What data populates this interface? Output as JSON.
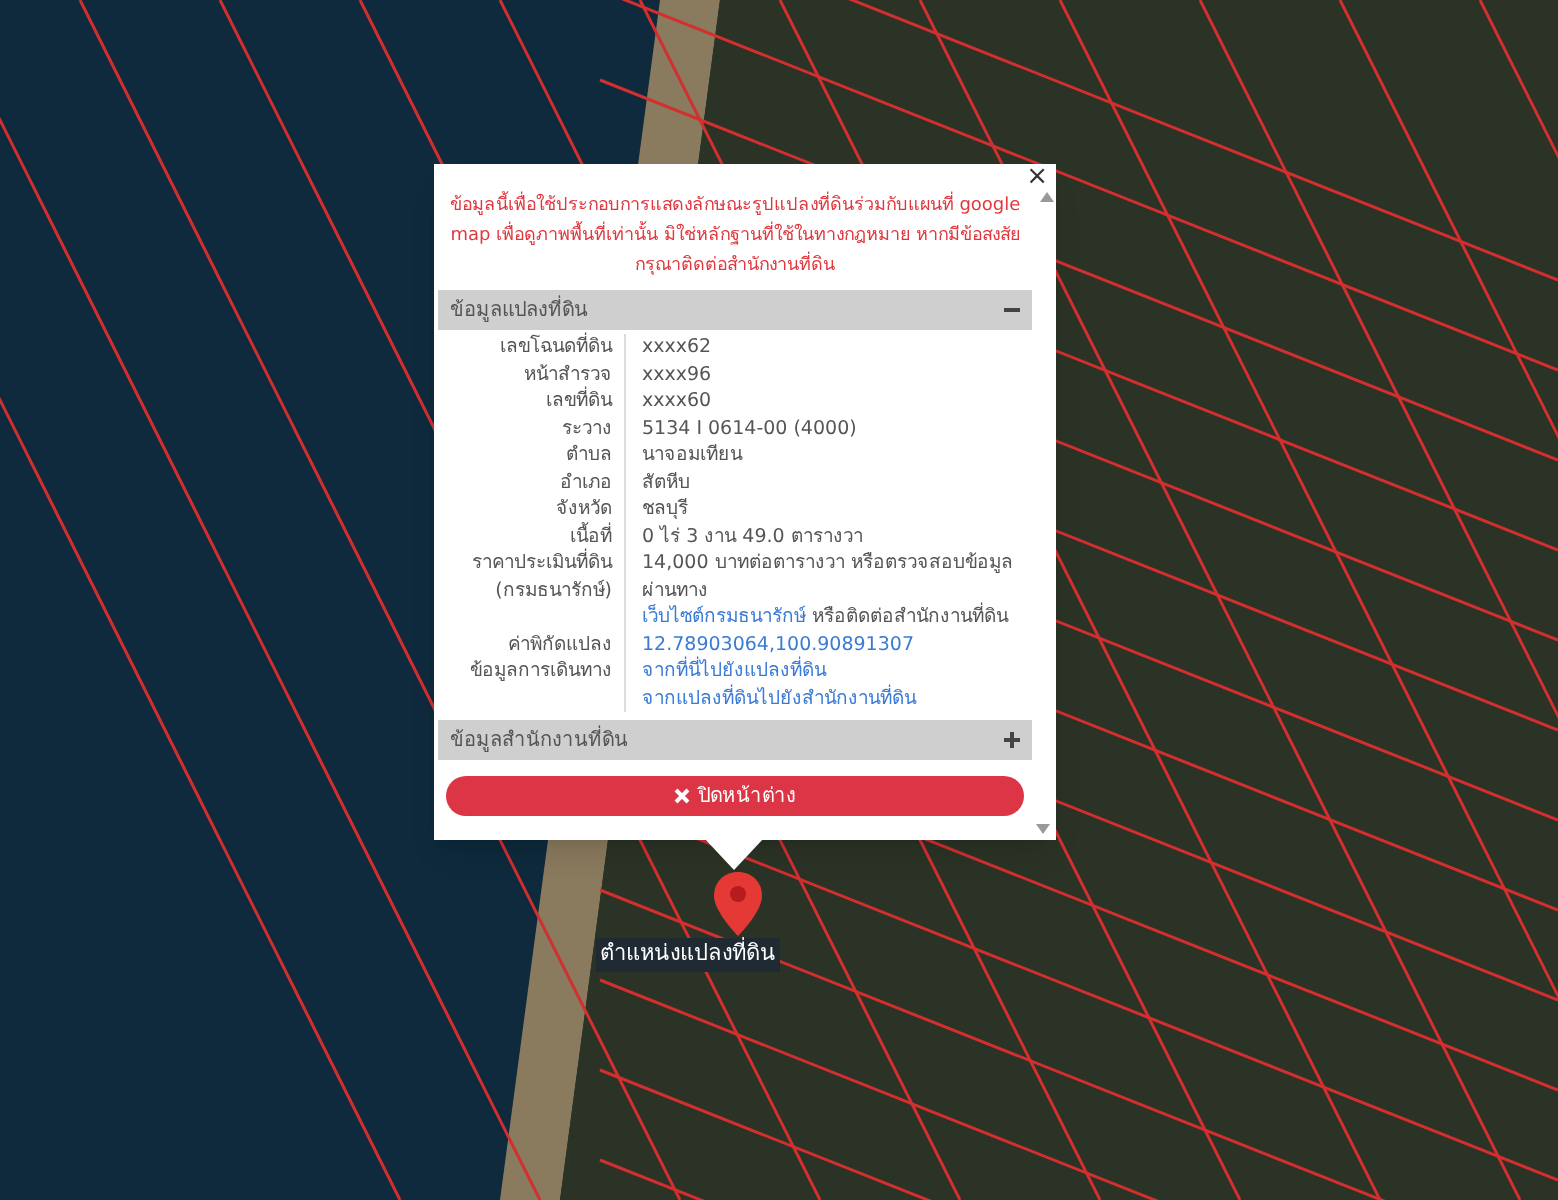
{
  "popup": {
    "close": "×",
    "notice": "ข้อมูลนี้เพื่อใช้ประกอบการแสดงลักษณะรูปแปลงที่ดินร่วมกับแผนที่ google map เพื่อดูภาพพื้นที่เท่านั้น มิใช่หลักฐานที่ใช้ในทางกฎหมาย หากมีข้อสงสัย กรุณาติดต่อสำนักงานที่ดิน",
    "sections": [
      {
        "title": "ข้อมูลแปลงที่ดิน",
        "expanded": true,
        "rows": [
          {
            "label": "เลขโฉนดที่ดิน",
            "parts": [
              {
                "text": "xxxx62",
                "link": false
              }
            ]
          },
          {
            "label": "หน้าสำรวจ",
            "parts": [
              {
                "text": "xxxx96",
                "link": false
              }
            ]
          },
          {
            "label": "เลขที่ดิน",
            "parts": [
              {
                "text": "xxxx60",
                "link": false
              }
            ]
          },
          {
            "label": "ระวาง",
            "parts": [
              {
                "text": "5134 I 0614-00 (4000)",
                "link": false
              }
            ]
          },
          {
            "label": "ตำบล",
            "parts": [
              {
                "text": "นาจอมเทียน",
                "link": false
              }
            ]
          },
          {
            "label": "อำเภอ",
            "parts": [
              {
                "text": "สัตหีบ",
                "link": false
              }
            ]
          },
          {
            "label": "จังหวัด",
            "parts": [
              {
                "text": "ชลบุรี",
                "link": false
              }
            ]
          },
          {
            "label": "เนื้อที่",
            "parts": [
              {
                "text": "0 ไร่ 3 งาน 49.0 ตารางวา",
                "link": false
              }
            ]
          },
          {
            "label": "ราคาประเมินที่ดิน\n(กรมธนารักษ์)",
            "parts": [
              {
                "text": "14,000 บาทต่อตารางวา หรือตรวจสอบข้อมูลผ่านทาง",
                "link": false
              },
              {
                "text": "เว็บไซต์กรมธนารักษ์",
                "link": true
              },
              {
                "text": "หรือติดต่อสำนักงานที่ดิน",
                "link": false
              }
            ]
          },
          {
            "label": "ค่าพิกัดแปลง",
            "parts": [
              {
                "text": "12.78903064,100.90891307",
                "link": true
              }
            ]
          },
          {
            "label": "ข้อมูลการเดินทาง",
            "parts": [
              {
                "text": "จากที่นี่ไปยังแปลงที่ดิน",
                "link": true
              }
            ]
          },
          {
            "label": "",
            "parts": [
              {
                "text": "จากแปลงที่ดินไปยังสำนักงานที่ดิน",
                "link": true
              }
            ]
          }
        ]
      },
      {
        "title": "ข้อมูลสำนักงานที่ดิน",
        "expanded": false
      }
    ],
    "close_button": "ปิดหน้าต่าง"
  },
  "marker": {
    "label": "ตำแหน่งแปลงที่ดิน"
  }
}
